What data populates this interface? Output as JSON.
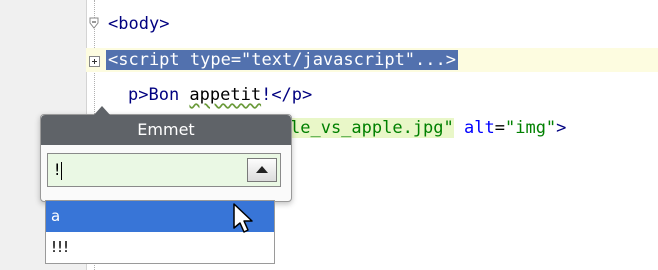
{
  "editor": {
    "lines": [
      {
        "tag_open": "<",
        "tag_name": "body",
        "tag_close": ">"
      },
      {
        "selected_text": "<script type=\"text/javascript\"...>"
      },
      {
        "text_tail": "p>Bon ",
        "squiggle_word": "appetit",
        "after": "!</p>"
      },
      {
        "green_text": "le_vs_apple.jpg\"",
        "space": " ",
        "attr": "alt",
        "eq": "=",
        "attr_val": "\"img\"",
        "end": ">"
      }
    ]
  },
  "emmet_popup": {
    "title": "Emmet",
    "input_value": "!",
    "dropdown_icon": "triangle-up-icon",
    "suggestions": [
      "a",
      "!!!"
    ],
    "selected_index": 0
  },
  "colors": {
    "selection": "#5271ae",
    "popup_header": "#5f6368",
    "suggest_active": "#3875d7",
    "input_bg": "#eaf8e4",
    "current_line": "#fdfce0"
  }
}
